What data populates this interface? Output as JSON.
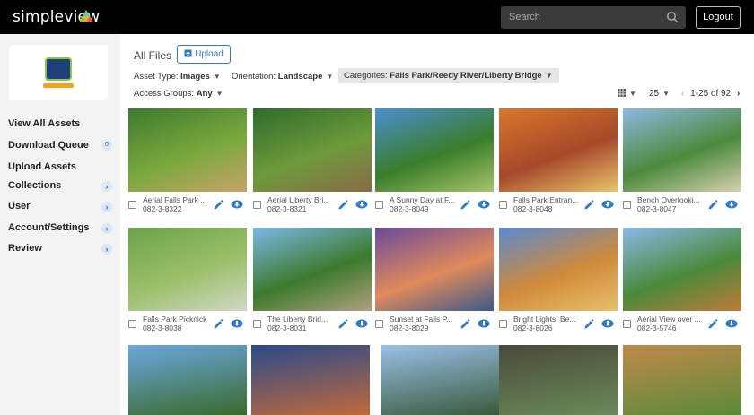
{
  "header": {
    "logo_text": "simpleview",
    "search_placeholder": "Search",
    "logout_label": "Logout"
  },
  "sidebar": {
    "items": [
      {
        "label": "View All Assets"
      },
      {
        "label": "Download Queue",
        "count": "0"
      },
      {
        "label": "Upload Assets"
      },
      {
        "label": "Collections",
        "arrow": "›"
      },
      {
        "label": "User",
        "arrow": "›"
      },
      {
        "label": "Account/Settings",
        "arrow": "›"
      },
      {
        "label": "Review",
        "arrow": "›"
      }
    ]
  },
  "main": {
    "title": "All Files",
    "upload_label": "Upload",
    "filters": {
      "asset_type_label": "Asset Type:",
      "asset_type_value": "Images",
      "orientation_label": "Orientation:",
      "orientation_value": "Landscape",
      "categories_label": "Categories:",
      "categories_value": "Falls Park/Reedy River/Liberty Bridge",
      "access_label": "Access Groups:",
      "access_value": "Any"
    },
    "per_page": "25",
    "pagination": "1-25 of 92"
  },
  "cards": [
    {
      "title": "Aerial Falls Park ...",
      "id": "082-3-8322"
    },
    {
      "title": "Aerial Liberty Bri...",
      "id": "082-3-8321"
    },
    {
      "title": "A Sunny Day at F...",
      "id": "082-3-8049"
    },
    {
      "title": "Falls Park Entran...",
      "id": "082-3-8048"
    },
    {
      "title": "Bench Overlooki...",
      "id": "082-3-8047"
    },
    {
      "title": "Falls Park Picknick",
      "id": "082-3-8038"
    },
    {
      "title": "The Liberty Brid...",
      "id": "082-3-8031"
    },
    {
      "title": "Sunset at Falls P...",
      "id": "082-3-8029"
    },
    {
      "title": "Bright Lights, Be...",
      "id": "082-3-8026"
    },
    {
      "title": "Aerial View over ...",
      "id": "082-3-5746"
    }
  ],
  "colors": {
    "accent": "#2b7bd6",
    "topbar": "#000000",
    "sidebar_bg": "#f3f3f3"
  }
}
